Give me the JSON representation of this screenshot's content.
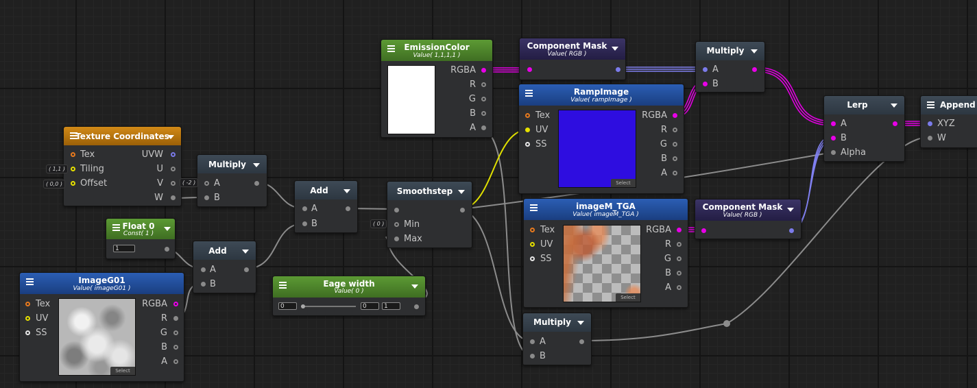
{
  "colors": {
    "background": "#202020",
    "node_body": "#2e2f31",
    "header_default": "#34404b",
    "header_green": "#4d8a2b",
    "header_orange": "#c57e10",
    "header_blue": "#2453a3",
    "header_purple": "#2f2855",
    "port_magenta": "#e800e8",
    "port_yellow": "#e6e000",
    "port_orange": "#e87a1e",
    "port_grey": "#8a8a8a",
    "port_white": "#e8e8e8",
    "port_lavender": "#7b7bea",
    "wire_grey": "#8c8c8c",
    "wire_magenta": "#e000e0",
    "wire_lavender": "#8080f0",
    "wire_yellow": "#e0e000",
    "ramp_preview": "#2e0de0"
  },
  "nodes": {
    "texture_coordinates": {
      "title": "Texture Coordinates",
      "inputs": [
        "Tex",
        "Tiling",
        "Offset"
      ],
      "outputs": [
        "UVW",
        "U",
        "V",
        "W"
      ],
      "tiling_value": "( 1,1 )",
      "offset_value": "( 0,0 )"
    },
    "multiply_1": {
      "title": "Multiply",
      "inputs": [
        "A",
        "B"
      ],
      "a_value": "( -2 )"
    },
    "float_0": {
      "title": "Float 0",
      "subtitle": "Const( 1 )",
      "field_value": "1"
    },
    "add_1": {
      "title": "Add",
      "inputs": [
        "A",
        "B"
      ]
    },
    "add_2": {
      "title": "Add",
      "inputs": [
        "A",
        "B"
      ]
    },
    "image_g01": {
      "title": "ImageG01",
      "subtitle": "Value( imageG01 )",
      "inputs": [
        "Tex",
        "UV",
        "SS"
      ],
      "outputs": [
        "RGBA",
        "R",
        "G",
        "B",
        "A"
      ],
      "select_label": "Select"
    },
    "edge_width": {
      "title": "Eage width",
      "subtitle": "Value( 0 )",
      "min": "0",
      "value": "0",
      "max": "1"
    },
    "smoothstep": {
      "title": "Smoothstep",
      "inputs": [
        "",
        "Min",
        "Max"
      ],
      "min_value": "( 0 )"
    },
    "emission_color": {
      "title": "EmissionColor",
      "subtitle": "Value( 1,1,1,1 )",
      "outputs": [
        "RGBA",
        "R",
        "G",
        "B",
        "A"
      ]
    },
    "component_mask_1": {
      "title": "Component Mask",
      "subtitle": "Value( RGB )"
    },
    "ramp_image": {
      "title": "RampImage",
      "subtitle": "Value( rampImage )",
      "inputs": [
        "Tex",
        "UV",
        "SS"
      ],
      "outputs": [
        "RGBA",
        "R",
        "G",
        "B",
        "A"
      ],
      "select_label": "Select"
    },
    "image_m_tga": {
      "title": "imageM_TGA",
      "subtitle": "Value( imageM_TGA )",
      "inputs": [
        "Tex",
        "UV",
        "SS"
      ],
      "outputs": [
        "RGBA",
        "R",
        "G",
        "B",
        "A"
      ],
      "select_label": "Select"
    },
    "component_mask_2": {
      "title": "Component Mask",
      "subtitle": "Value( RGB )"
    },
    "multiply_2": {
      "title": "Multiply",
      "inputs": [
        "A",
        "B"
      ]
    },
    "multiply_3": {
      "title": "Multiply",
      "inputs": [
        "A",
        "B"
      ]
    },
    "lerp": {
      "title": "Lerp",
      "inputs": [
        "A",
        "B",
        "Alpha"
      ]
    },
    "append": {
      "title": "Append",
      "inputs": [
        "XYZ",
        "W"
      ]
    }
  }
}
